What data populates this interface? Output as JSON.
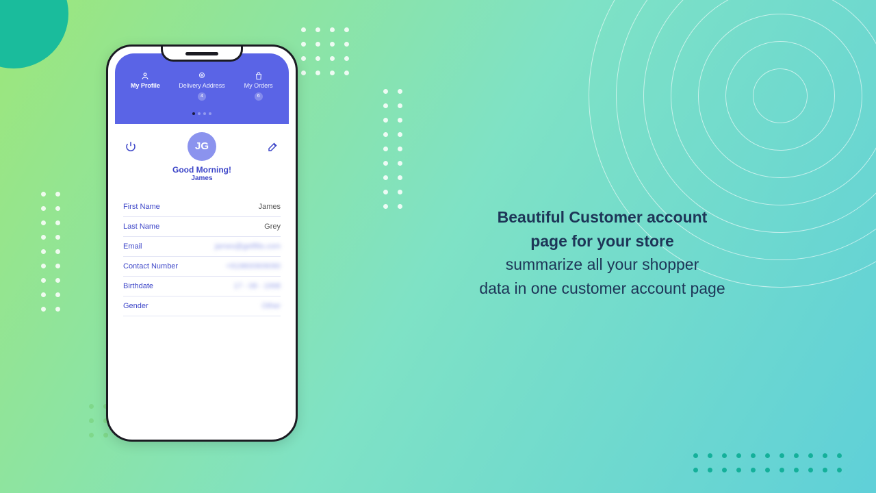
{
  "marketing": {
    "bold_line1": "Beautiful Customer account",
    "bold_line2": "page for your store",
    "line3": "summarize all your shopper",
    "line4": "data in one customer account page"
  },
  "tabs": {
    "profile": {
      "label": "My Profile"
    },
    "address": {
      "label": "Delivery Address",
      "badge": "4"
    },
    "orders": {
      "label": "My Orders",
      "badge": "6"
    }
  },
  "profile": {
    "initials": "JG",
    "greeting": "Good Morning!",
    "name": "James"
  },
  "fields": {
    "first_name": {
      "label": "First Name",
      "value": "James"
    },
    "last_name": {
      "label": "Last Name",
      "value": "Grey"
    },
    "email": {
      "label": "Email",
      "value": "james@getflits.com"
    },
    "contact": {
      "label": "Contact Number",
      "value": "+919800909090"
    },
    "birthdate": {
      "label": "Birthdate",
      "value": "17 - 08 - 1998"
    },
    "gender": {
      "label": "Gender",
      "value": "Other"
    }
  }
}
